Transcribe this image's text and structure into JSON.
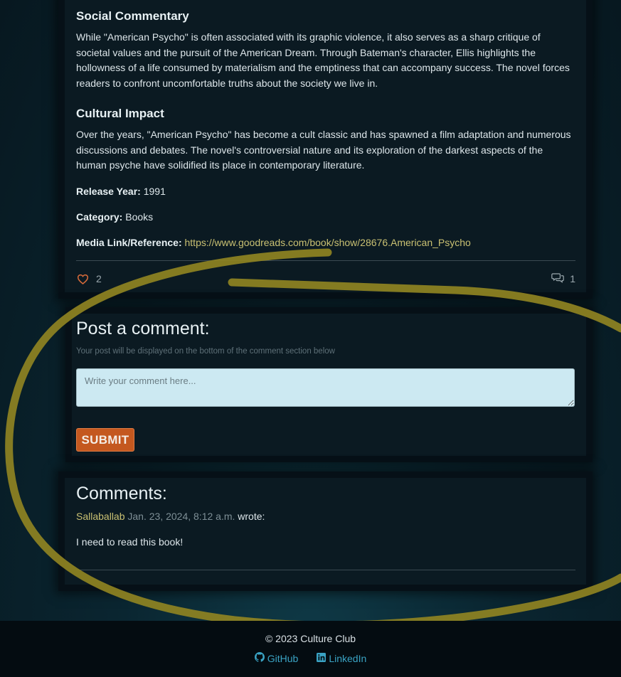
{
  "article": {
    "social_heading": "Social Commentary",
    "social_text": "While \"American Psycho\" is often associated with its graphic violence, it also serves as a sharp critique of societal values and the pursuit of the American Dream. Through Bateman's character, Ellis highlights the hollowness of a life consumed by materialism and the emptiness that can accompany success. The novel forces readers to confront uncomfortable truths about the society we live in.",
    "cultural_heading": "Cultural Impact",
    "cultural_text": "Over the years, \"American Psycho\" has become a cult classic and has spawned a film adaptation and numerous discussions and debates. The novel's controversial nature and its exploration of the darkest aspects of the human psyche have solidified its place in contemporary literature.",
    "release_label": "Release Year:",
    "release_value": "1991",
    "category_label": "Category:",
    "category_value": "Books",
    "media_label": "Media Link/Reference:",
    "media_url": "https://www.goodreads.com/book/show/28676.American_Psycho",
    "likes": "2",
    "comments_count": "1"
  },
  "comment_form": {
    "title": "Post a comment:",
    "hint": "Your post will be displayed on the bottom of the comment section below",
    "placeholder": "Write your comment here...",
    "submit_label": "SUBMIT"
  },
  "comments": {
    "title": "Comments:",
    "items": [
      {
        "author": "Sallaballab",
        "date": "Jan. 23, 2024, 8:12 a.m.",
        "wrote": "wrote:",
        "text": "I need to read this book!"
      }
    ]
  },
  "footer": {
    "copyright": "© 2023 Culture Club",
    "github_label": "GitHub",
    "linkedin_label": "LinkedIn"
  },
  "colors": {
    "accent_link": "#c9c072",
    "submit": "#c4581f",
    "annotation": "#8f8322",
    "footer_link": "#3aa3c4"
  },
  "icons": [
    "heart-icon",
    "comments-icon",
    "github-icon",
    "linkedin-icon"
  ]
}
